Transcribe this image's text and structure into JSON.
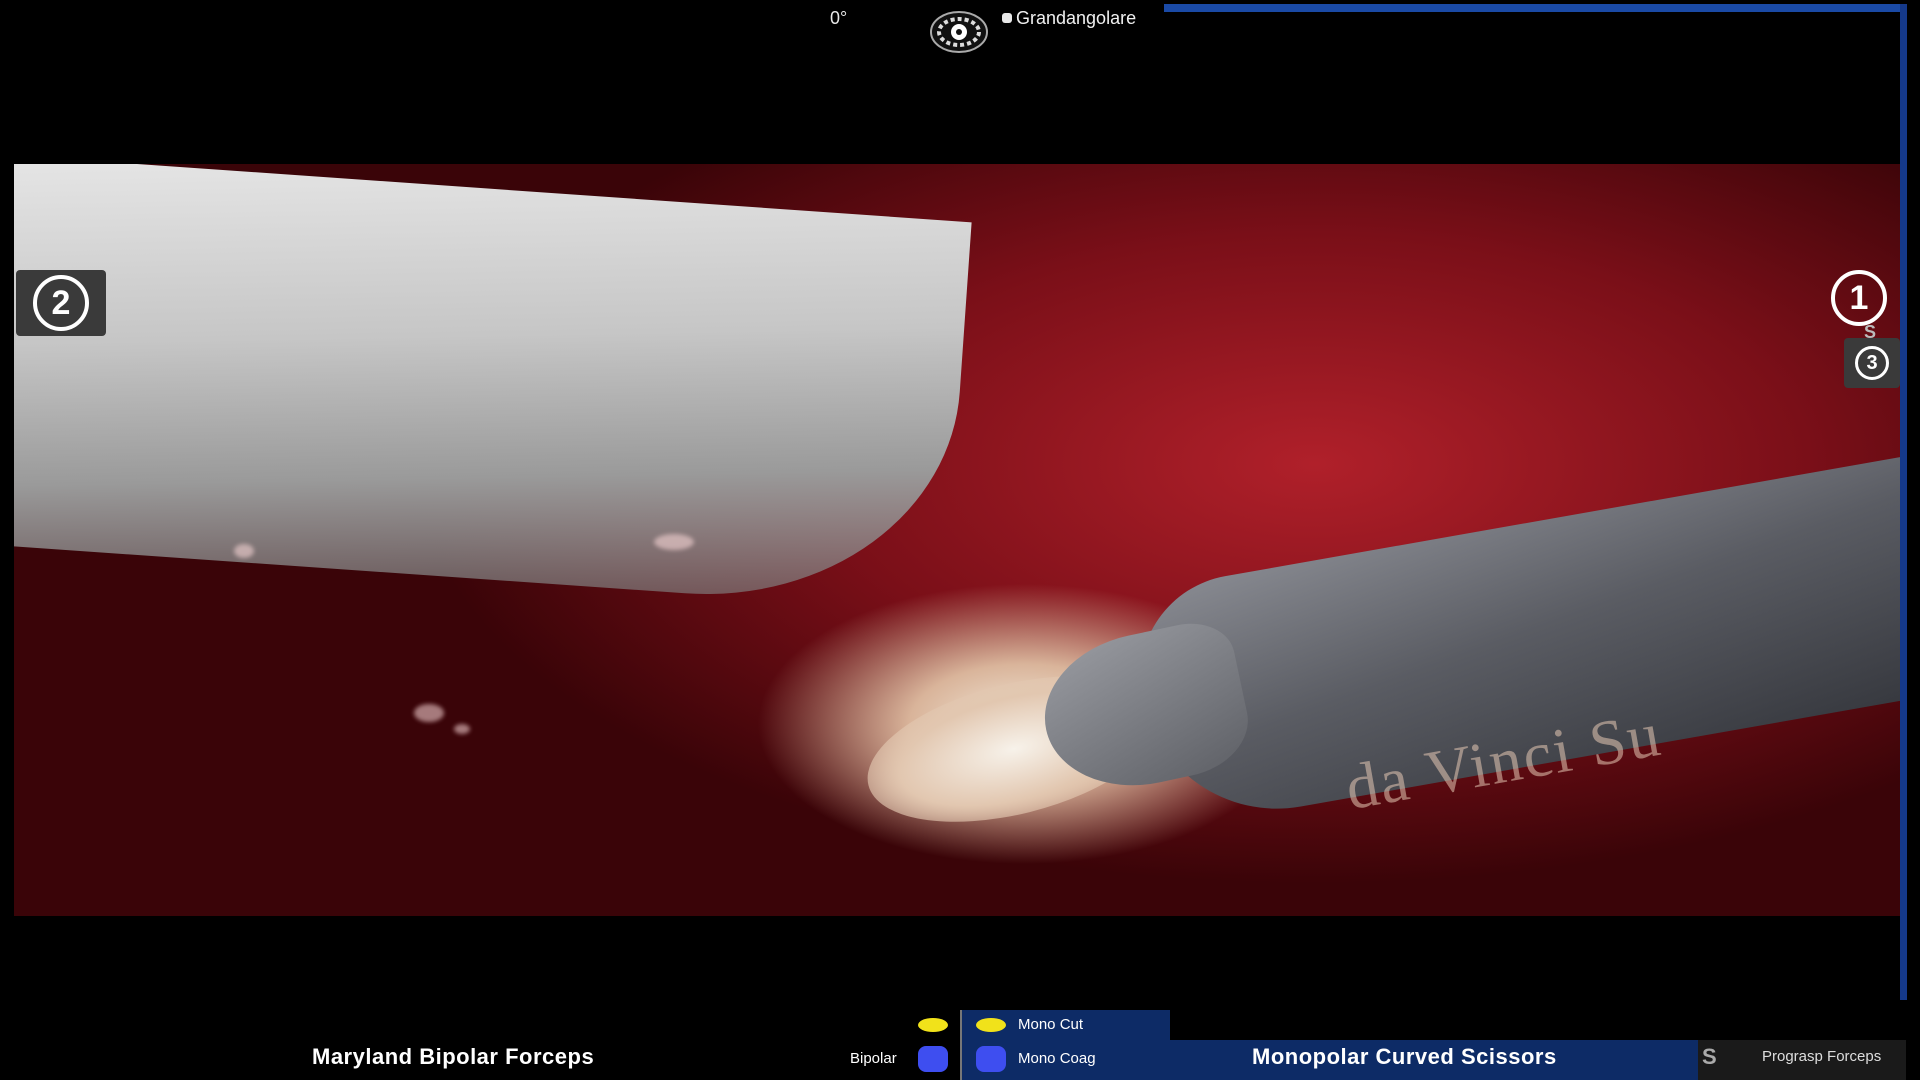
{
  "header": {
    "angle": "0°",
    "camera_label": "Grandangolare",
    "camera_icon": "endoscope-camera-icon"
  },
  "arms": {
    "left_number": "2",
    "right_number": "1",
    "right_sub": "S",
    "third_number": "3"
  },
  "view": {
    "engraving": "da Vinci Su"
  },
  "footer": {
    "left_instrument": "Maryland Bipolar Forceps",
    "bipolar_label": "Bipolar",
    "mono_cut_label": "Mono Cut",
    "mono_coag_label": "Mono Coag",
    "right_instrument": "Monopolar Curved Scissors",
    "third_arm_marker": "S",
    "third_instrument": "Prograsp Forceps"
  },
  "colors": {
    "energy_cut": "#f1e21a",
    "energy_coag": "#3e4ef0",
    "panel_blue": "#0d2b66",
    "accent_line": "#1a4aa6"
  }
}
